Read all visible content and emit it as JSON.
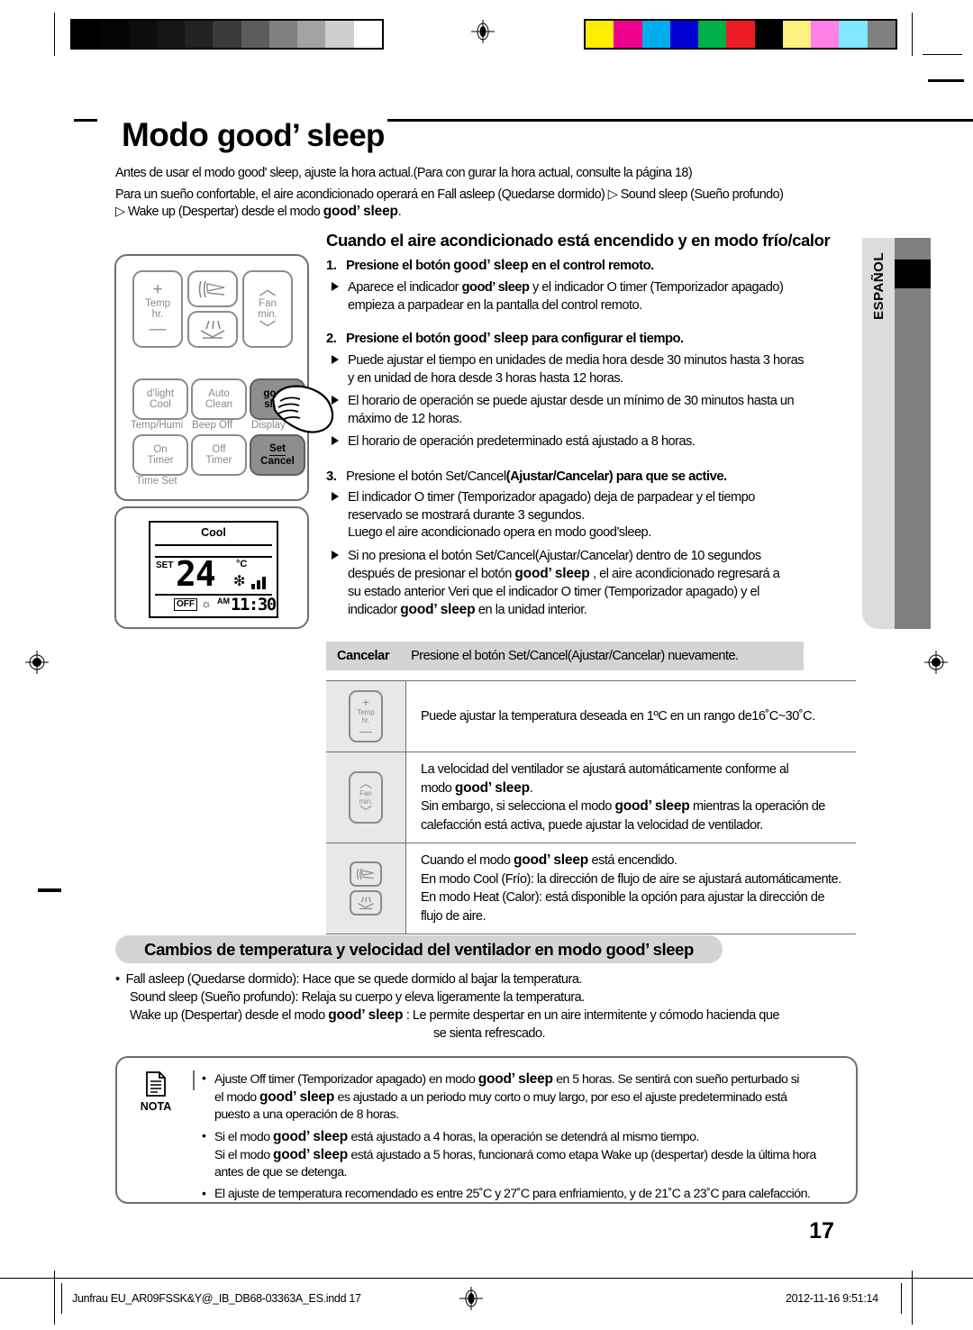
{
  "document": {
    "title_prefix": "Modo ",
    "title_brand": "good’ sleep",
    "page_number": "17"
  },
  "intro": {
    "line1": "Antes de usar el modo good' sleep, ajuste la hora actual.(Para con gurar la hora actual, consulte la página 18)",
    "line2": "Para un sueño confortable, el aire acondicionado operará en Fall asleep (Quedarse dormido) ▷ Sound sleep (Sueño profundo)",
    "line3_pre": "▷ Wake up (Despertar) desde el modo ",
    "line3_brand": "good’ sleep",
    "line3_post": "."
  },
  "language_tab": {
    "label": "ESPAÑOL"
  },
  "remote": {
    "buttons": {
      "temp_plus": "+",
      "temp_label1": "Temp",
      "temp_label2": "hr.",
      "temp_minus": "—",
      "fan_up": "︿",
      "fan_label1": "Fan",
      "fan_label2": "min.",
      "fan_down": "﹀",
      "dlight_l1": "d’light",
      "dlight_l2": "Cool",
      "auto_l1": "Auto",
      "auto_l2": "Clean",
      "good_l1": "good’",
      "good_l2": "sleep",
      "on_l1": "On",
      "on_l2": "Timer",
      "off_l1": "Off",
      "off_l2": "Timer",
      "set_l1": "Set",
      "set_l2": "Cancel"
    },
    "sublabels": {
      "temp_humi": "Temp/Humi",
      "beep_off": "Beep Off",
      "display": "Display",
      "time_set": "Time Set"
    }
  },
  "lcd": {
    "mode": "Cool",
    "set_label": "SET",
    "temperature": "24",
    "unit": "°C",
    "fan_icon": "fan-icon",
    "off_badge": "OFF",
    "sleep_icon": "sleep-icon",
    "ampm": "AM",
    "time": "11:30"
  },
  "main": {
    "section_heading": "Cuando el aire acondicionado está encendido y en modo frío/calor",
    "steps": [
      {
        "num": "1.",
        "title_pre": "Presione el botón ",
        "title_brand": "good’ sleep",
        "title_post": " en el control remoto.",
        "bullets": [
          {
            "lines": [
              {
                "pre": "Aparece el indicador ",
                "brand": "good’ sleep",
                "post": " y el indicador O  timer (Temporizador apagado)"
              },
              {
                "pre": "empieza a parpadear en la pantalla del control remoto.",
                "brand": "",
                "post": ""
              }
            ]
          }
        ]
      },
      {
        "num": "2.",
        "title_pre": "Presione el botón ",
        "title_brand": "good’ sleep",
        "title_post": " para configurar el tiempo.",
        "bullets": [
          {
            "lines": [
              {
                "pre": "Puede ajustar el tiempo en unidades de media hora desde 30 minutos hasta 3 horas",
                "brand": "",
                "post": ""
              },
              {
                "pre": "y en unidad de hora desde 3 horas hasta 12 horas.",
                "brand": "",
                "post": ""
              }
            ]
          },
          {
            "lines": [
              {
                "pre": "El horario de operación se puede ajustar desde un mínimo de 30 minutos hasta un",
                "brand": "",
                "post": ""
              },
              {
                "pre": "máximo de 12 horas.",
                "brand": "",
                "post": ""
              }
            ]
          },
          {
            "lines": [
              {
                "pre": "El horario de operación predeterminado está ajustado a 8 horas.",
                "brand": "",
                "post": ""
              }
            ]
          }
        ]
      },
      {
        "num": "3.",
        "title_pre": "Presione el botón Set/Cancel",
        "title_brand": "(Ajustar/Cancelar) para que se active.",
        "title_post": "",
        "bullets": [
          {
            "lines": [
              {
                "pre": "El indicador O  timer (Temporizador apagado) deja de parpadear y el tiempo",
                "brand": "",
                "post": ""
              },
              {
                "pre": "reservado se mostrará durante 3 segundos.",
                "brand": "",
                "post": ""
              },
              {
                "pre": "Luego el aire acondicionado opera en modo good’sleep.",
                "brand": "",
                "post": ""
              }
            ]
          },
          {
            "lines": [
              {
                "pre": "Si no presiona el botón Set/Cancel(Ajustar/Cancelar) dentro de 10 segundos",
                "brand": "",
                "post": ""
              },
              {
                "pre": "después de presionar el botón ",
                "brand": "good’ sleep",
                "post": " , el aire acondicionado regresará a"
              },
              {
                "pre": "su estado anterior  Veri  que el indicador O  timer (Temporizador apagado) y el",
                "brand": "",
                "post": ""
              },
              {
                "pre": "indicador ",
                "brand": "good’ sleep",
                "post": " en la unidad interior."
              }
            ]
          }
        ]
      }
    ]
  },
  "cancel_row": {
    "label": "Cancelar",
    "text": "Presione el botón Set/Cancel(Ajustar/Cancelar) nuevamente."
  },
  "function_table": {
    "rows": [
      {
        "icon": "temp-updown-button-icon",
        "icon_plus": "+",
        "icon_l1": "Temp",
        "icon_l2": "hr.",
        "icon_minus": "—",
        "lines": [
          {
            "pre": "Puede ajustar la temperatura deseada en 1ºC en un rango de16˚C~30˚C.",
            "brand": "",
            "post": ""
          }
        ]
      },
      {
        "icon": "fan-updown-button-icon",
        "icon_plus": "︿",
        "icon_l1": "Fan",
        "icon_l2": "min.",
        "icon_minus": "﹀",
        "lines": [
          {
            "pre": "La velocidad del ventilador se ajustará automáticamente conforme al",
            "brand": "",
            "post": ""
          },
          {
            "pre": "modo ",
            "brand": "good’ sleep",
            "post": "."
          },
          {
            "pre": "Sin embargo, si selecciona el modo ",
            "brand": "good’ sleep",
            "post": " mientras la operación de"
          },
          {
            "pre": "calefacción está activa, puede ajustar la velocidad de ventilador.",
            "brand": "",
            "post": ""
          }
        ]
      },
      {
        "icon": "airflow-direction-buttons-icon",
        "icon_plus": "",
        "icon_l1": "",
        "icon_l2": "",
        "icon_minus": "",
        "lines": [
          {
            "pre": "Cuando el modo ",
            "brand": "good’ sleep",
            "post": " está encendido."
          },
          {
            "pre": "En modo Cool (Frío): la dirección de flujo de aire se ajustará automáticamente.",
            "brand": "",
            "post": ""
          },
          {
            "pre": "En modo Heat (Calor): está disponible la opción para ajustar la dirección de",
            "brand": "",
            "post": ""
          },
          {
            "pre": "flujo de aire.",
            "brand": "",
            "post": ""
          }
        ]
      }
    ]
  },
  "section2": {
    "heading_pre": "Cambios de temperatura y velocidad del ventilador en modo ",
    "heading_brand": "good’ sleep",
    "lines": [
      {
        "style": "bullet",
        "pre": "Fall asleep (Quedarse dormido):  Hace que se quede dormido al bajar la temperatura.",
        "brand": "",
        "post": ""
      },
      {
        "style": "indent",
        "pre": "Sound sleep (Sueño profundo): Relaja su cuerpo y eleva ligeramente la temperatura.",
        "brand": "",
        "post": ""
      },
      {
        "style": "indent",
        "pre": "Wake up (Despertar) desde el modo ",
        "brand": "good’ sleep",
        "post": " : Le permite despertar en un aire intermitente y cómodo hacienda que"
      },
      {
        "style": "center",
        "pre": "se sienta refrescado.",
        "brand": "",
        "post": ""
      }
    ]
  },
  "nota": {
    "label": "NOTA",
    "icon": "note-document-icon",
    "items": [
      {
        "lines": [
          {
            "pre": "Ajuste Off timer (Temporizador apagado) en modo ",
            "brand": "good’ sleep",
            "post": " en 5 horas. Se sentirá con sueño perturbado si"
          },
          {
            "pre": "el modo ",
            "brand": "good’ sleep",
            "post": " es ajustado a un periodo muy corto o muy largo, por eso el ajuste predeterminado está"
          },
          {
            "pre": "puesto a una operación de 8 horas.",
            "brand": "",
            "post": ""
          }
        ]
      },
      {
        "lines": [
          {
            "pre": "Si el modo ",
            "brand": "good’ sleep",
            "post": " está ajustado a 4 horas, la operación se detendrá al mismo tiempo."
          },
          {
            "pre": "Si el modo ",
            "brand": "good’ sleep",
            "post": " está ajustado a 5 horas, funcionará como etapa Wake up (despertar) desde la última hora"
          },
          {
            "pre": "antes de que se detenga.",
            "brand": "",
            "post": ""
          }
        ]
      },
      {
        "lines": [
          {
            "pre": "El ajuste de temperatura recomendado es entre 25˚C y 27˚C para enfriamiento, y de 21˚C a 23˚C para calefacción.",
            "brand": "",
            "post": ""
          }
        ]
      }
    ]
  },
  "footer": {
    "left": "Junfrau EU_AR09FSSK&Y@_IB_DB68-03363A_ES.indd  17",
    "right": "2012-11-16   9:51:14"
  },
  "calibration": {
    "grayscale": [
      "#000000",
      "#050505",
      "#0d0d0d",
      "#161616",
      "#222222",
      "#3a3a3a",
      "#5c5c5c",
      "#808080",
      "#a3a3a3",
      "#cfcfcf",
      "#ffffff"
    ],
    "colors": [
      "#ffed00",
      "#ec008c",
      "#00aeef",
      "#0000d4",
      "#00b14a",
      "#ed1c24",
      "#000000",
      "#fff07f",
      "#ff80e6",
      "#80e8ff",
      "#808080"
    ]
  }
}
